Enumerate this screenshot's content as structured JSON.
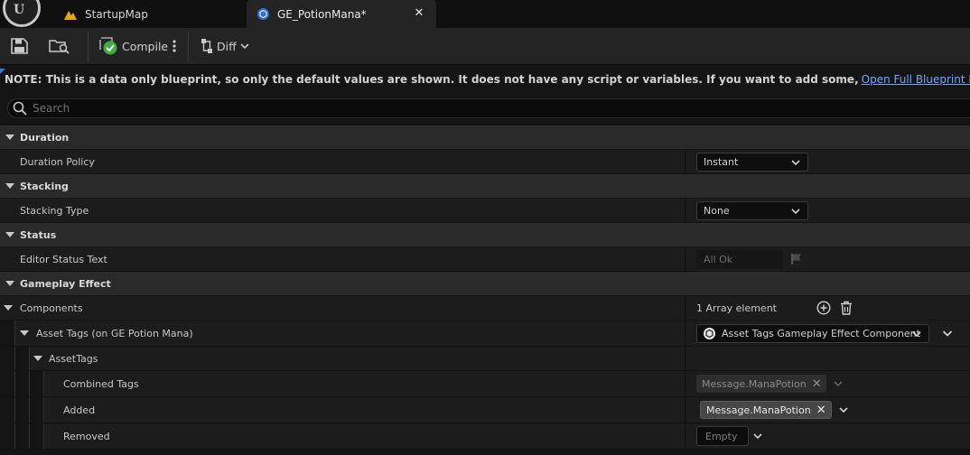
{
  "tabs": [
    {
      "label": "StartupMap",
      "icon": "level-icon"
    },
    {
      "label": "GE_PotionMana*",
      "icon": "blueprint-icon"
    }
  ],
  "toolbar": {
    "compile_label": "Compile",
    "diff_label": "Diff"
  },
  "note": {
    "text": "NOTE: This is a data only blueprint, so only the default values are shown.  It does not have any script or variables.  If you want to add some,",
    "link": "Open Full Blueprint Editor"
  },
  "search": {
    "placeholder": "Search"
  },
  "details": {
    "duration": {
      "category": "Duration",
      "policy_label": "Duration Policy",
      "policy_value": "Instant"
    },
    "stacking": {
      "category": "Stacking",
      "type_label": "Stacking Type",
      "type_value": "None"
    },
    "status": {
      "category": "Status",
      "editor_status_label": "Editor Status Text",
      "editor_status_value": "All Ok"
    },
    "gameplay_effect": {
      "category": "Gameplay Effect",
      "components_label": "Components",
      "components_value": "1 Array element",
      "asset_tags_label": "Asset Tags (on GE Potion Mana)",
      "asset_tags_value": "Asset Tags Gameplay Effect Component",
      "asset_tags_sub_label": "AssetTags",
      "combined_label": "Combined Tags",
      "combined_value": "Message.ManaPotion",
      "added_label": "Added",
      "added_value": "Message.ManaPotion",
      "removed_label": "Removed",
      "removed_value": "Empty"
    }
  },
  "colors": {
    "accent_blue": "#2f7fe0",
    "link": "#6fa8ff",
    "compile_ok": "#3fae3f",
    "level_icon": "#e8a321"
  }
}
